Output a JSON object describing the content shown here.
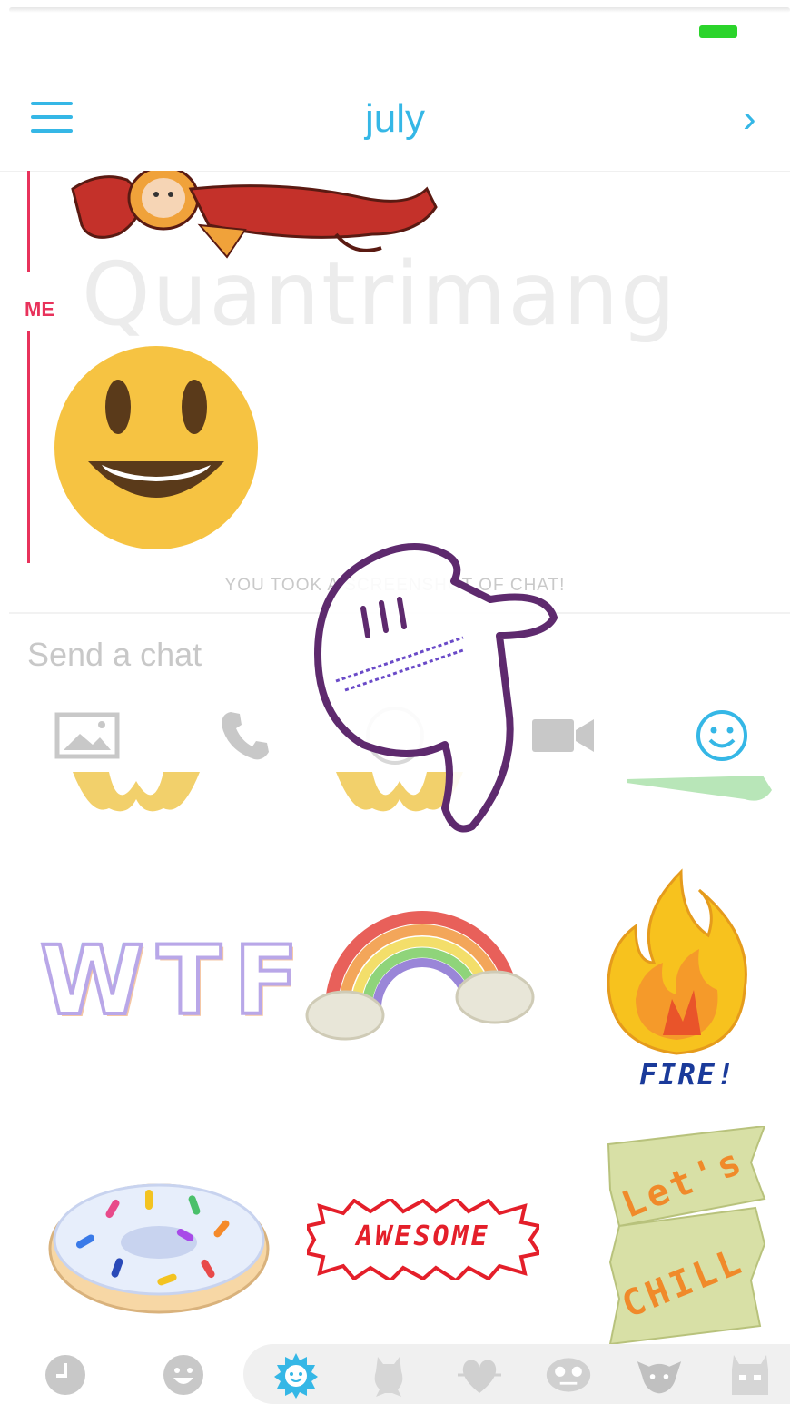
{
  "header": {
    "title": "july"
  },
  "chat": {
    "me_label": "ME",
    "watermark": "Quantrimang",
    "screenshot_notice": "YOU TOOK A SCREENSHOT OF CHAT!"
  },
  "input": {
    "placeholder": "Send a chat"
  },
  "actions": [
    {
      "icon": "photo-icon"
    },
    {
      "icon": "phone-icon"
    },
    {
      "icon": "camera-icon"
    },
    {
      "icon": "video-icon"
    },
    {
      "icon": "emoji-icon",
      "active": true
    }
  ],
  "stickers": {
    "wtf": "WTF",
    "fire": "FIRE!",
    "awesome": "AWESOME",
    "chill_line1": "Let's",
    "chill_line2": "CHILL"
  },
  "categories": [
    {
      "icon": "recent-clock-icon"
    },
    {
      "icon": "smiley-icon"
    },
    {
      "icon": "sun-icon",
      "active": true
    },
    {
      "icon": "character-icon"
    },
    {
      "icon": "heart-icon"
    },
    {
      "icon": "face-icon"
    },
    {
      "icon": "creature-icon"
    },
    {
      "icon": "monster-icon"
    }
  ],
  "colors": {
    "accent": "#35b7e6",
    "me": "#e8325b",
    "battery": "#2bd42b",
    "icon_gray": "#c8c8c8"
  }
}
